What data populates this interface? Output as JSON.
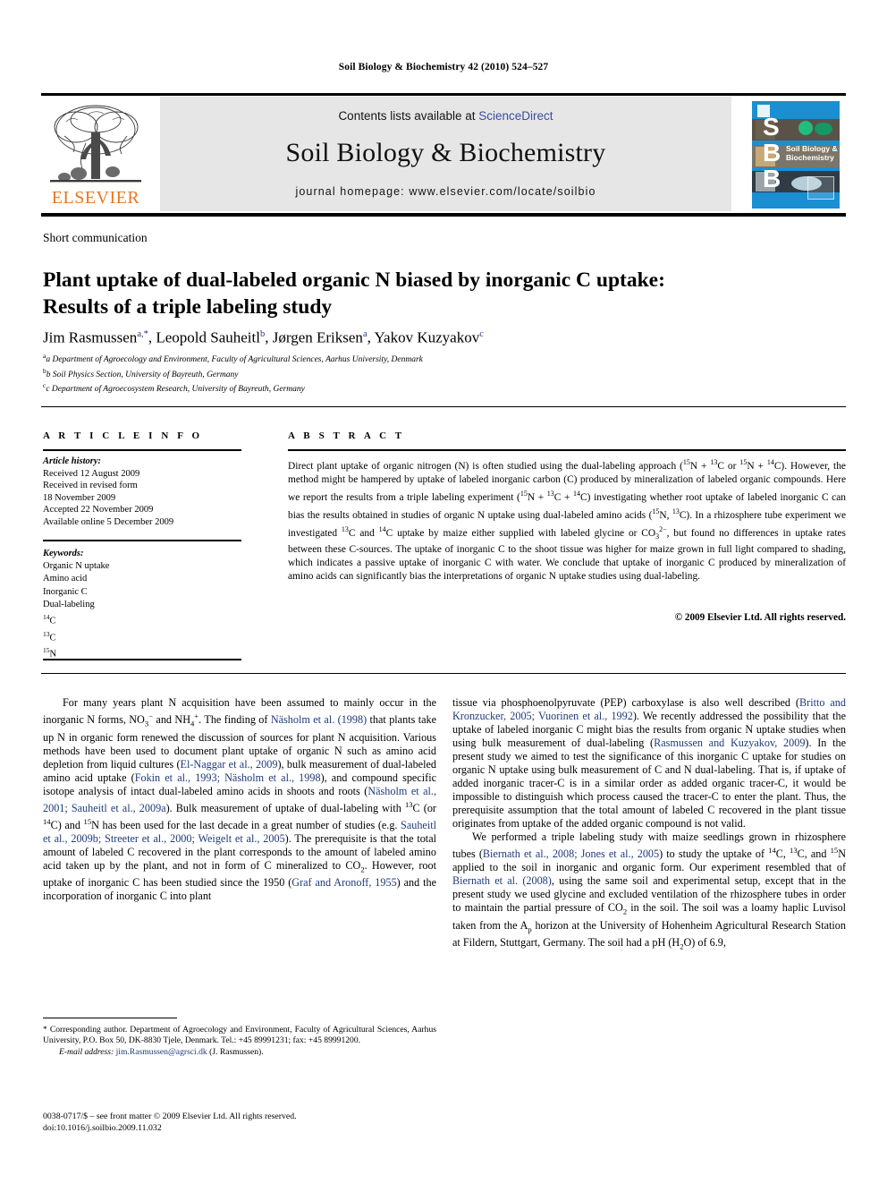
{
  "running_head": "Soil Biology & Biochemistry 42 (2010) 524–527",
  "masthead": {
    "publisher_name": "ELSEVIER",
    "contents_prefix": "Contents lists available at ",
    "contents_link": "ScienceDirect",
    "journal_title": "Soil Biology & Biochemistry",
    "homepage": "journal homepage: www.elsevier.com/locate/soilbio",
    "cover": {
      "letters": "S\nB\nB",
      "title_line1": "Soil Biology &",
      "title_line2": "Biochemistry"
    }
  },
  "article": {
    "type_label": "Short communication",
    "title_line1": "Plant uptake of dual-labeled organic N biased by inorganic C uptake:",
    "title_line2": "Results of a triple labeling study",
    "authors_html": "Jim Rasmussen<sup>a,*</sup>, Leopold Sauheitl<sup>b</sup>, Jørgen Eriksen<sup>a</sup>, Yakov Kuzyakov<sup>c</sup>",
    "affiliations": [
      "a Department of Agroecology and Environment, Faculty of Agricultural Sciences, Aarhus University, Denmark",
      "b Soil Physics Section, University of Bayreuth, Germany",
      "c Department of Agroecosystem Research, University of Bayreuth, Germany"
    ]
  },
  "info": {
    "heading": "A R T I C L E   I N F O",
    "history_label": "Article history:",
    "history": [
      "Received 12 August 2009",
      "Received in revised form",
      "18 November 2009",
      "Accepted 22 November 2009",
      "Available online 5 December 2009"
    ],
    "keywords_label": "Keywords:",
    "keywords": [
      "Organic N uptake",
      "Amino acid",
      "Inorganic C",
      "Dual-labeling"
    ],
    "keyword_isotopes": [
      {
        "mass": "14",
        "element": "C"
      },
      {
        "mass": "13",
        "element": "C"
      },
      {
        "mass": "15",
        "element": "N"
      }
    ]
  },
  "abstract": {
    "heading": "A B S T R A C T",
    "text_html": "Direct plant uptake of organic nitrogen (N) is often studied using the dual-labeling approach (<sup>15</sup>N&nbsp;+&nbsp;<sup>13</sup>C or <sup>15</sup>N&nbsp;+&nbsp;<sup>14</sup>C). However, the method might be hampered by uptake of labeled inorganic carbon (C) produced by mineralization of labeled organic compounds. Here we report the results from a triple labeling experiment (<sup>15</sup>N&nbsp;+&nbsp;<sup>13</sup>C&nbsp;+&nbsp;<sup>14</sup>C) investigating whether root uptake of labeled inorganic C can bias the results obtained in studies of organic N uptake using dual-labeled amino acids (<sup>15</sup>N, <sup>13</sup>C). In a rhizosphere tube experiment we investigated <sup>13</sup>C and <sup>14</sup>C uptake by maize either supplied with labeled glycine or CO<sub>3</sub><sup>2&minus;</sup>, but found no differences in uptake rates between these C-sources. The uptake of inorganic C to the shoot tissue was higher for maize grown in full light compared to shading, which indicates a passive uptake of inorganic C with water. We conclude that uptake of inorganic C produced by mineralization of amino acids can significantly bias the interpretations of organic N uptake studies using dual-labeling.",
    "copyright": "© 2009 Elsevier Ltd. All rights reserved."
  },
  "body": {
    "left_col_html": "<p>For many years plant N acquisition have been assumed to mainly occur in the inorganic N forms, NO<sub>3</sub><sup>&minus;</sup> and NH<sub>4</sub><sup>+</sup>. The finding of <span class=\"ref\">Näsholm et al. (1998)</span> that plants take up N in organic form renewed the discussion of sources for plant N acquisition. Various methods have been used to document plant uptake of organic N such as amino acid depletion from liquid cultures (<span class=\"ref\">El-Naggar et al., 2009</span>), bulk measurement of dual-labeled amino acid uptake (<span class=\"ref\">Fokin et al., 1993; Näsholm et al., 1998</span>), and compound specific isotope analysis of intact dual-labeled amino acids in shoots and roots (<span class=\"ref\">Näsholm et al., 2001; Sauheitl et al., 2009a</span>). Bulk measurement of uptake of dual-labeling with <sup>13</sup>C (or <sup>14</sup>C) and <sup>15</sup>N has been used for the last decade in a great number of studies (e.g. <span class=\"ref\">Sauheitl et al., 2009b; Streeter et al., 2000; Weigelt et al., 2005</span>). The prerequisite is that the total amount of labeled C recovered in the plant corresponds to the amount of labeled amino acid taken up by the plant, and not in form of C mineralized to CO<sub>2</sub>. However, root uptake of inorganic C has been studied since the 1950 (<span class=\"ref\">Graf and Aronoff, 1955</span>) and the incorporation of inorganic C into plant</p>",
    "right_col_html": "<p class=\"cont\">tissue via phosphoenolpyruvate (PEP) carboxylase is also well described (<span class=\"ref\">Britto and Kronzucker, 2005; Vuorinen et al., 1992</span>). We recently addressed the possibility that the uptake of labeled inorganic C might bias the results from organic N uptake studies when using bulk measurement of dual-labeling (<span class=\"ref\">Rasmussen and Kuzyakov, 2009</span>). In the present study we aimed to test the significance of this inorganic C uptake for studies on organic N uptake using bulk measurement of C and N dual-labeling. That is, if uptake of added inorganic tracer-C is in a similar order as added organic tracer-C, it would be impossible to distinguish which process caused the tracer-C to enter the plant. Thus, the prerequisite assumption that the total amount of labeled C recovered in the plant tissue originates from uptake of the added organic compound is not valid.</p><p>We performed a triple labeling study with maize seedlings grown in rhizosphere tubes (<span class=\"ref\">Biernath et al., 2008; Jones et al., 2005</span>) to study the uptake of <sup>14</sup>C, <sup>13</sup>C, and <sup>15</sup>N applied to the soil in inorganic and organic form. Our experiment resembled that of <span class=\"ref\">Biernath et al. (2008)</span>, using the same soil and experimental setup, except that in the present study we used glycine and excluded ventilation of the rhizosphere tubes in order to maintain the partial pressure of CO<sub>2</sub> in the soil. The soil was a loamy haplic Luvisol taken from the A<sub>p</sub> horizon at the University of Hohenheim Agricultural Research Station at Fildern, Stuttgart, Germany. The soil had a pH (H<sub>2</sub>O) of 6.9,</p>"
  },
  "footnotes": {
    "corresponding_html": "* Corresponding author. Department of Agroecology and Environment, Faculty of Agricultural Sciences, Aarhus University, P.O. Box 50, DK-8830 Tjele, Denmark. Tel.: +45 89991231; fax: +45 89991200.",
    "email_label": "E-mail address:",
    "email": "jim.Rasmussen@agrsci.dk",
    "email_suffix": "(J. Rasmussen).",
    "issn_line": "0038-0717/$ – see front matter © 2009 Elsevier Ltd. All rights reserved.",
    "doi_line": "doi:10.1016/j.soilbio.2009.11.032"
  }
}
